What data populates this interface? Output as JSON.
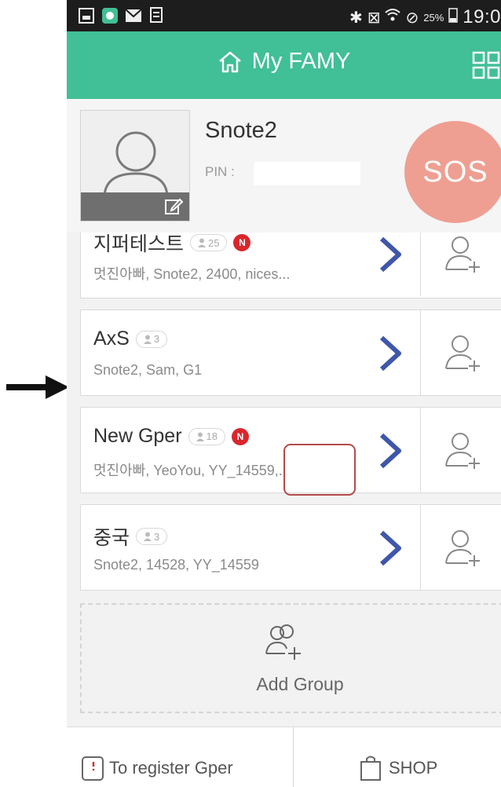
{
  "status_bar": {
    "battery_percent": "25%",
    "time": "19:0"
  },
  "header": {
    "title": "My FAMY",
    "accent_color": "#41bf96"
  },
  "profile": {
    "name": "Snote2",
    "pin_label": "PIN :",
    "sos_label": "SOS",
    "sos_color": "#ee9f92"
  },
  "groups": [
    {
      "name": "지퍼테스트",
      "count": "25",
      "has_new": true,
      "new_label": "N",
      "members": "멋진아빠, Snote2, 2400, nices..."
    },
    {
      "name": "AxS",
      "count": "3",
      "has_new": false,
      "members": "Snote2, Sam, G1"
    },
    {
      "name": "New Gper",
      "count": "18",
      "has_new": true,
      "new_label": "N",
      "members": "멋진아빠, YeoYou, YY_14559,.."
    },
    {
      "name": "중국",
      "count": "3",
      "has_new": false,
      "members": "Snote2, 14528, YY_14559"
    }
  ],
  "add_group": {
    "label": "Add Group"
  },
  "bottom_bar": {
    "register_label": "To register Gper",
    "shop_label": "SHOP"
  },
  "icons": {
    "home": "home-icon",
    "grid": "grid-menu-icon",
    "avatar": "default-avatar-icon",
    "edit": "edit-icon",
    "chevron": "chevron-right-icon",
    "add_member": "add-person-icon",
    "add_group": "add-group-icon",
    "register": "register-card-icon",
    "shop": "shopping-bag-icon"
  }
}
